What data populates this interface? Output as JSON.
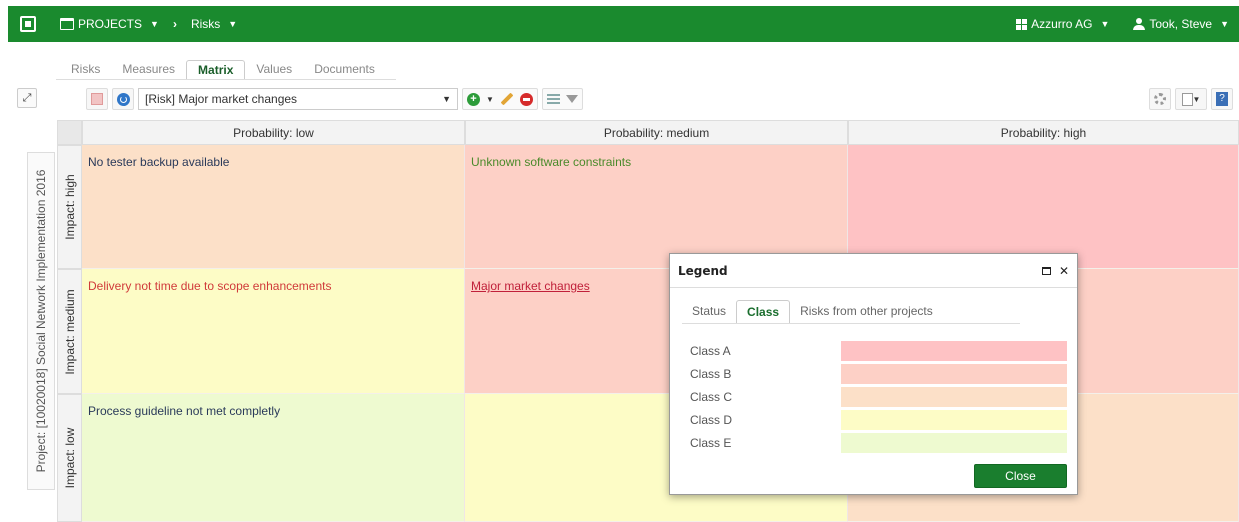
{
  "topbar": {
    "projects_label": "PROJECTS",
    "breadcrumb_label": "Risks",
    "company_label": "Azzurro AG",
    "user_label": "Took, Steve"
  },
  "tabs": [
    "Risks",
    "Measures",
    "Matrix",
    "Values",
    "Documents"
  ],
  "active_tab": "Matrix",
  "toolbar": {
    "risk_select_value": "[Risk] Major market changes"
  },
  "project_label": "Project: [10020018] Social Network Implementation 2016",
  "matrix": {
    "columns": [
      "Probability: low",
      "Probability: medium",
      "Probability: high"
    ],
    "rows": [
      "Impact: high",
      "Impact: medium",
      "Impact: low"
    ],
    "cells": {
      "high_low": "No tester backup available",
      "high_medium": "Unknown software constraints",
      "high_high": "",
      "medium_low": "Delivery not time due to scope enhancements",
      "medium_medium": "Major market changes",
      "medium_high": "",
      "low_low": "Process guideline not met completly",
      "low_medium": "",
      "low_high": ""
    },
    "cell_colors": {
      "high_low": "#fce0c8",
      "high_medium": "#fdd0c6",
      "high_high": "#fec2c4",
      "medium_low": "#fdfcc6",
      "medium_medium": "#fdd0c6",
      "medium_high": "#fdd0c6",
      "low_low": "#eefad0",
      "low_medium": "#fdfcc6",
      "low_high": "#fce0c8"
    }
  },
  "legend_dialog": {
    "title": "Legend",
    "tabs": [
      "Status",
      "Class",
      "Risks from other projects"
    ],
    "active_tab": "Class",
    "classes": [
      {
        "label": "Class A",
        "color": "#fec2c4"
      },
      {
        "label": "Class B",
        "color": "#fdd0c6"
      },
      {
        "label": "Class C",
        "color": "#fce0c8"
      },
      {
        "label": "Class D",
        "color": "#fdfcc6"
      },
      {
        "label": "Class E",
        "color": "#eefad0"
      }
    ],
    "close_label": "Close"
  },
  "colors": {
    "brand_green": "#1a8a2e"
  }
}
